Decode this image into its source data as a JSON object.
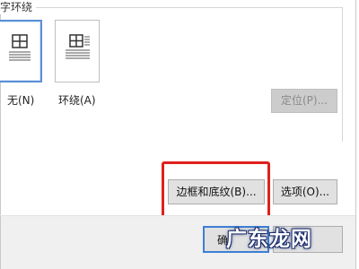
{
  "wrapping": {
    "section_title": "字环绕",
    "options": [
      {
        "id": "none",
        "label": "无(N)",
        "selected": true
      },
      {
        "id": "wrap",
        "label": "环绕(A)",
        "selected": false
      }
    ]
  },
  "buttons": {
    "position": {
      "label": "定位(P)...",
      "disabled": true
    },
    "borders_shading": {
      "label": "边框和底纹(B)..."
    },
    "options": {
      "label": "选项(O)..."
    },
    "ok": {
      "label": "确"
    },
    "cancel": {
      "label": ""
    }
  },
  "watermark": {
    "text": "广东龙网"
  },
  "colors": {
    "highlight": "#e0201b",
    "selection": "#5a8fd6",
    "default_button_border": "#3c7fd4"
  }
}
